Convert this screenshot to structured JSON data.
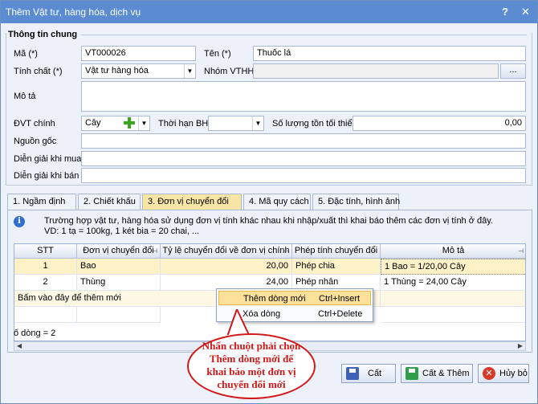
{
  "window": {
    "title": "Thêm Vật tư, hàng hóa, dịch vụ",
    "help_label": "?",
    "close_label": "✕"
  },
  "general": {
    "header": "Thông tin chung",
    "ma_label": "Mã (*)",
    "ma_value": "VT000026",
    "ten_label": "Tên (*)",
    "ten_value": "Thuốc lá",
    "tinhchat_label": "Tính chất (*)",
    "tinhchat_value": "Vật tư hàng hóa",
    "nhom_label": "Nhóm VTHH",
    "nhom_value": "",
    "nhom_button": "...",
    "mota_label": "Mô tả",
    "mota_value": "",
    "dvt_label": "ĐVT chính",
    "dvt_value": "Cây",
    "thoihan_label": "Thời hạn BH",
    "thoihan_value": "",
    "soluong_label": "Số lượng tồn tối thiểu",
    "soluong_value": "0,00",
    "nguongoc_label": "Nguồn gốc",
    "nguongoc_value": "",
    "diengiai_mua_label": "Diễn giải khi mua",
    "diengiai_mua_value": "",
    "diengiai_ban_label": "Diễn giải khi bán",
    "diengiai_ban_value": ""
  },
  "tabs": [
    {
      "label": "1. Ngầm định"
    },
    {
      "label": "2. Chiết khấu"
    },
    {
      "label": "3. Đơn vị chuyển đổi"
    },
    {
      "label": "4. Mã quy cách"
    },
    {
      "label": "5. Đặc tính, hình ảnh"
    }
  ],
  "info": {
    "line1": "Trường hợp vật tư, hàng hóa sử dụng đơn vị tính khác nhau khi nhập/xuất thì khai báo thêm các đơn vị tính ở đây.",
    "line2": "VD: 1 tạ = 100kg, 1 két bia = 20 chai, ..."
  },
  "grid": {
    "columns": [
      "STT",
      "Đơn vị chuyển đổi",
      "Tỷ lệ chuyển đổi về đơn vị chính",
      "Phép tính chuyển đổi",
      "Mô tả"
    ],
    "rows": [
      {
        "stt": "1",
        "unit": "Bao",
        "ratio": "20,00",
        "op": "Phép chia",
        "desc": "1 Bao = 1/20,00 Cây"
      },
      {
        "stt": "2",
        "unit": "Thùng",
        "ratio": "24,00",
        "op": "Phép nhân",
        "desc": "1 Thùng = 24,00 Cây"
      }
    ],
    "add_row_text": "Bấm vào đây để thêm mới",
    "footer": "ố dòng = 2"
  },
  "context_menu": {
    "items": [
      {
        "label": "Thêm dòng mới",
        "shortcut": "Ctrl+Insert"
      },
      {
        "label": "Xóa dòng",
        "shortcut": "Ctrl+Delete"
      }
    ]
  },
  "callout": {
    "line1": "Nhấn chuột phải chọn",
    "line2": "Thêm dòng mới để",
    "line3": "khai báo một đơn vị",
    "line4": "chuyển đổi mới"
  },
  "buttons": {
    "save": "Cất",
    "save_new": "Cất & Thêm",
    "cancel": "Hủy bỏ"
  },
  "colors": {
    "title_bar": "#5B8BD0",
    "active_tab": "#F7E5A6",
    "callout_red": "#D01818"
  }
}
